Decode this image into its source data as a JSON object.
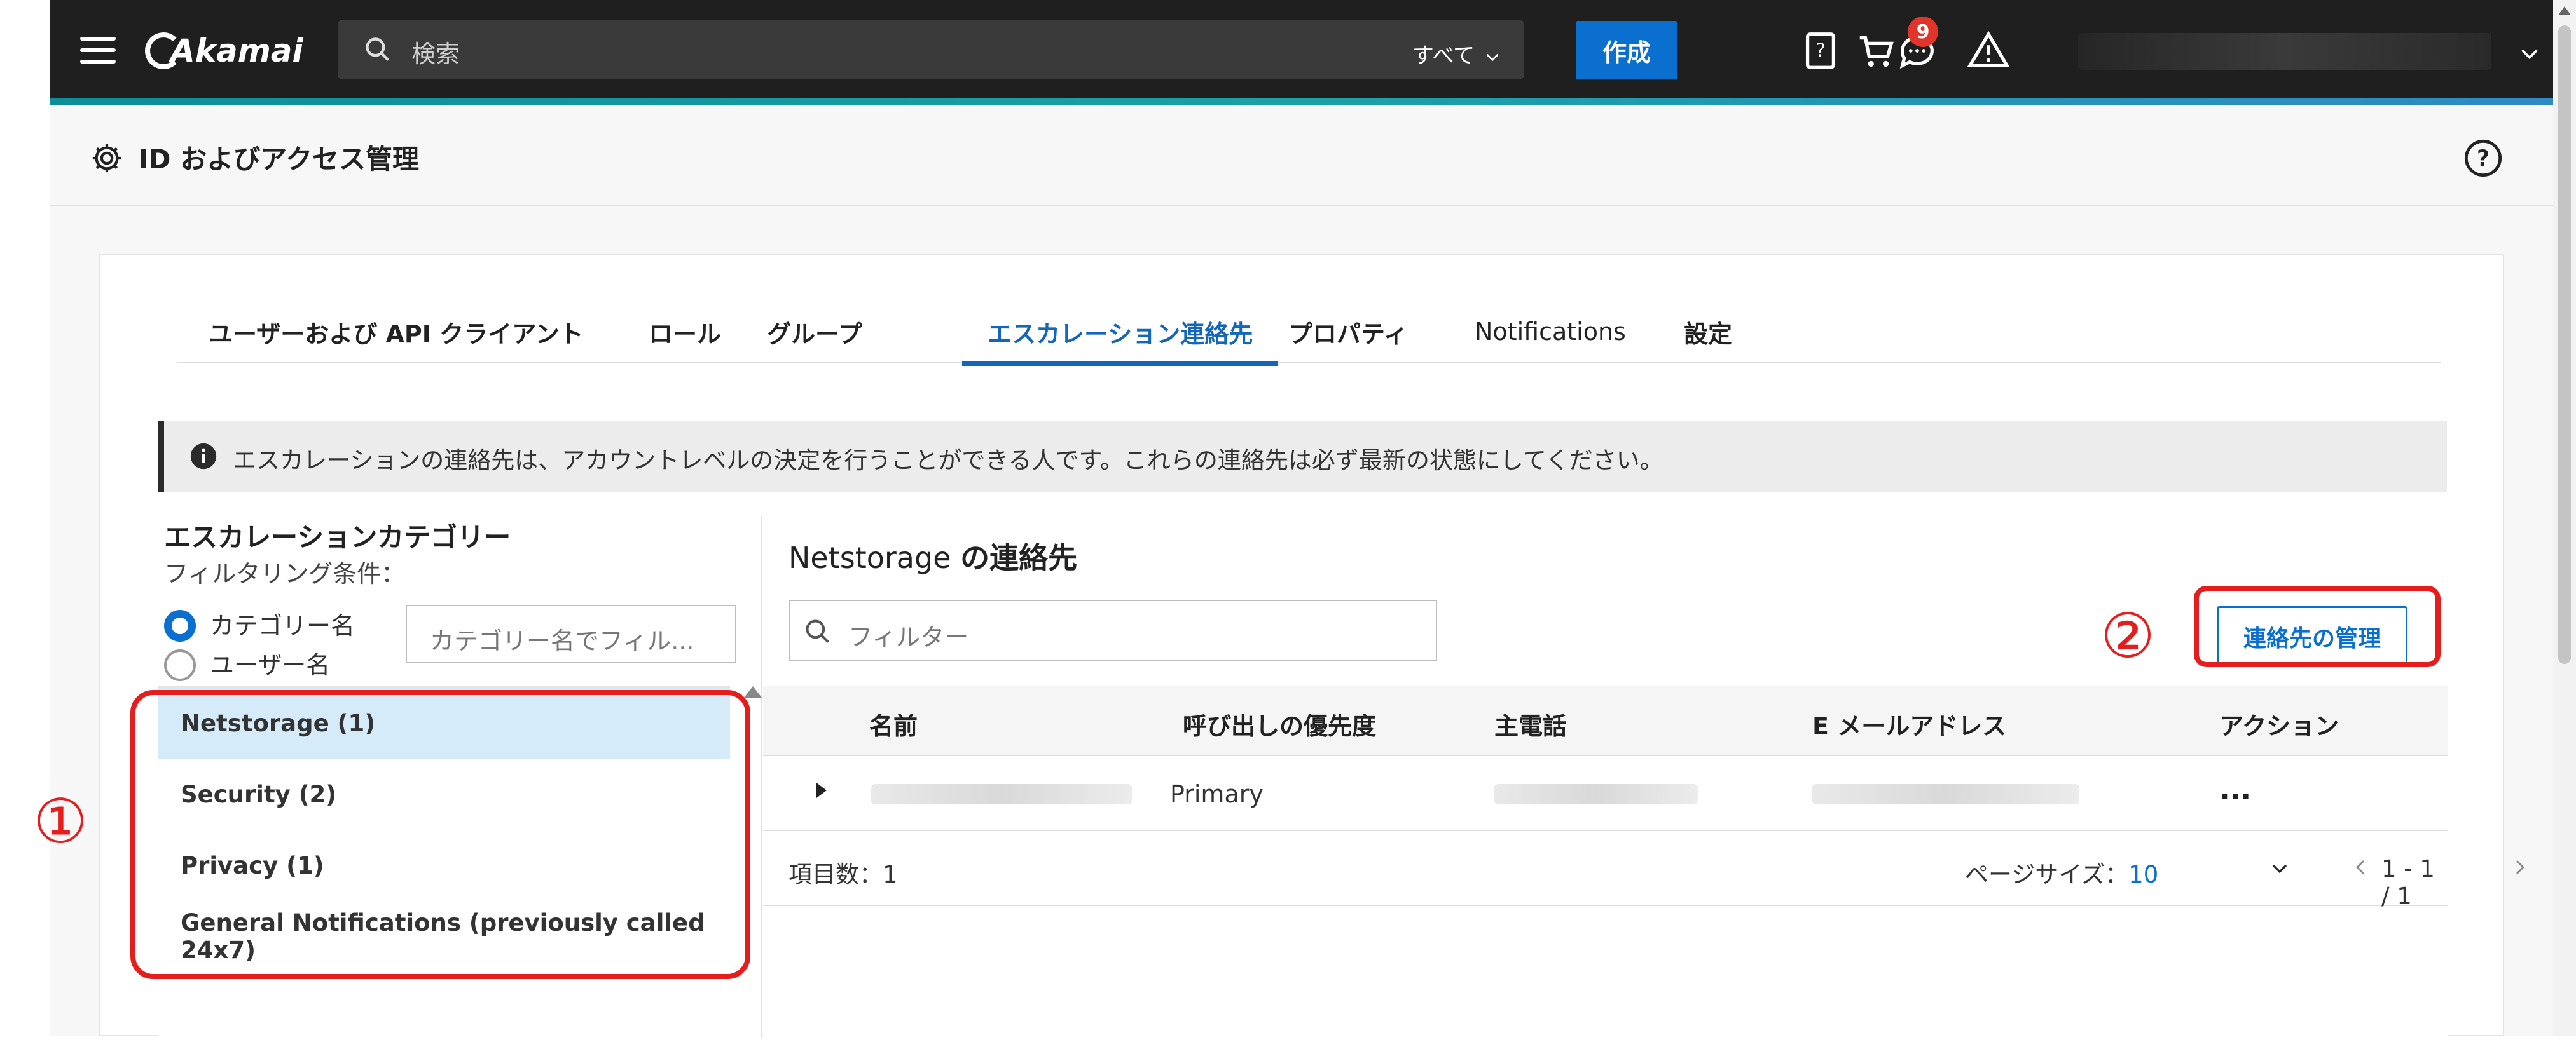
{
  "topbar": {
    "logo": "Akamai",
    "search_placeholder": "検索",
    "search_scope": "すべて",
    "create_label": "作成",
    "notification_count": "9",
    "icons": [
      "help-book-icon",
      "cart-icon",
      "chat-icon",
      "warning-icon"
    ]
  },
  "page": {
    "title": "ID およびアクセス管理"
  },
  "tabs": [
    {
      "label": "ユーザーおよび API クライアント"
    },
    {
      "label": "ロール"
    },
    {
      "label": "グループ"
    },
    {
      "label": "エスカレーション連絡先"
    },
    {
      "label": "プロパティ"
    },
    {
      "label": "Notifications"
    },
    {
      "label": "設定"
    }
  ],
  "active_tab": "エスカレーション連絡先",
  "info": {
    "text": "エスカレーションの連絡先は、アカウントレベルの決定を行うことができる人です。これらの連絡先は必ず最新の状態にしてください。"
  },
  "categories": {
    "heading": "エスカレーションカテゴリー",
    "filter_heading": "フィルタリング条件：",
    "radio_category": "カテゴリー名",
    "radio_user": "ユーザー名",
    "selected_radio": "カテゴリー名",
    "filter_placeholder": "カテゴリー名でフィル...",
    "items": [
      {
        "label": "Netstorage (1)"
      },
      {
        "label": "Security (2)"
      },
      {
        "label": "Privacy (1)"
      },
      {
        "label": "General Notifications (previously called 24x7)"
      }
    ],
    "selected": "Netstorage (1)"
  },
  "contacts": {
    "title_bold": "の連絡先",
    "title_name": "Netstorage",
    "filter_placeholder": "フィルター",
    "manage_button": "連絡先の管理",
    "columns": [
      "名前",
      "呼び出しの優先度",
      "主電話",
      "E メールアドレス",
      "アクション"
    ],
    "rows": [
      {
        "priority": "Primary",
        "action": "..."
      }
    ],
    "footer": {
      "count_label": "項目数：1",
      "page_size_label": "ページサイズ：",
      "page_size_value": "10",
      "pages": "1 - 1 / 1"
    }
  },
  "annotations": {
    "marker_1": "①",
    "marker_2": "②"
  },
  "colors": {
    "topbar": "#1f1f1f",
    "accent_blue": "#0b6fd0",
    "annotation_red": "#e51d1d",
    "selected_row": "#d6ebfa"
  }
}
